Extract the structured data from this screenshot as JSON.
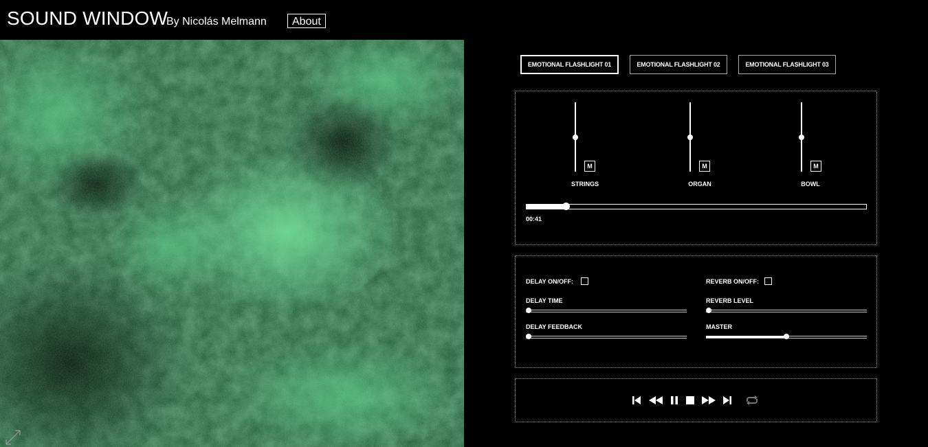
{
  "header": {
    "title": "SOUND WINDOW",
    "byline": "By Nicolás Melmann",
    "about_label": "About"
  },
  "tabs": [
    {
      "label": "EMOTIONAL FLASHLIGHT 01",
      "active": true
    },
    {
      "label": "EMOTIONAL FLASHLIGHT 02",
      "active": false
    },
    {
      "label": "EMOTIONAL FLASHLIGHT 03",
      "active": false
    }
  ],
  "mixer": {
    "channels": [
      {
        "label": "STRINGS",
        "mute_label": "M",
        "level": 0.5
      },
      {
        "label": "ORGAN",
        "mute_label": "M",
        "level": 0.5
      },
      {
        "label": "BOWL",
        "mute_label": "M",
        "level": 0.5
      }
    ],
    "progress": 0.115,
    "time": "00:41"
  },
  "effects": {
    "delay_toggle_label": "DELAY ON/OFF:",
    "delay_on": false,
    "reverb_toggle_label": "REVERB ON/OFF:",
    "reverb_on": false,
    "delay_time_label": "DELAY TIME",
    "delay_time": 0.0,
    "reverb_level_label": "REVERB LEVEL",
    "reverb_level": 0.0,
    "delay_feedback_label": "DELAY FEEDBACK",
    "delay_feedback": 0.0,
    "master_label": "MASTER",
    "master": 0.5
  },
  "transport": {
    "icons": [
      "skip-back-icon",
      "rewind-icon",
      "pause-icon",
      "stop-icon",
      "fast-forward-icon",
      "skip-forward-icon",
      "loop-icon"
    ]
  },
  "colors": {
    "background": "#000000",
    "foreground": "#ffffff",
    "visual_green": "#4fbf7a"
  }
}
